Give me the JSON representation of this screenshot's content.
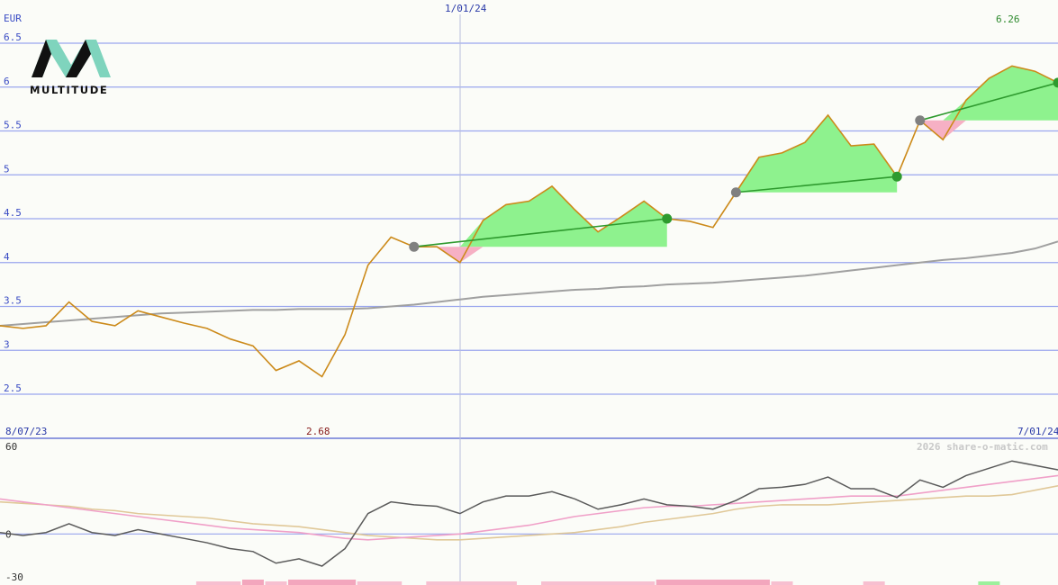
{
  "chart_data": {
    "type": "line",
    "currency": "EUR",
    "last_value": "6.26",
    "min_label": "2.68",
    "date_start": "8/07/23",
    "date_mid": "1/01/24",
    "date_end": "7/01/24",
    "watermark": "2026 share-o-matic.com",
    "logo_text": "MULTITUDE",
    "price": {
      "ylim": [
        2.5,
        6.5
      ],
      "yticks": [
        "2.5",
        "3",
        "3.5",
        "4",
        "4.5",
        "5",
        "5.5",
        "6",
        "6.5"
      ],
      "values": [
        3.28,
        3.25,
        3.28,
        3.55,
        3.33,
        3.28,
        3.45,
        3.38,
        3.31,
        3.25,
        3.13,
        3.05,
        2.77,
        2.88,
        2.7,
        3.18,
        3.97,
        4.29,
        4.18,
        4.18,
        4.0,
        4.48,
        4.66,
        4.7,
        4.87,
        4.6,
        4.35,
        4.52,
        4.7,
        4.5,
        4.47,
        4.4,
        4.8,
        5.2,
        5.25,
        5.37,
        5.68,
        5.33,
        5.35,
        4.98,
        5.62,
        5.4,
        5.85,
        6.1,
        6.24,
        6.18,
        6.05
      ],
      "ma_long": [
        3.28,
        3.3,
        3.32,
        3.34,
        3.36,
        3.38,
        3.4,
        3.42,
        3.43,
        3.44,
        3.45,
        3.46,
        3.46,
        3.47,
        3.47,
        3.47,
        3.48,
        3.5,
        3.52,
        3.55,
        3.58,
        3.61,
        3.63,
        3.65,
        3.67,
        3.69,
        3.7,
        3.72,
        3.73,
        3.75,
        3.76,
        3.77,
        3.79,
        3.81,
        3.83,
        3.85,
        3.88,
        3.91,
        3.94,
        3.97,
        4.0,
        4.03,
        4.05,
        4.08,
        4.11,
        4.16,
        4.24
      ]
    },
    "trades": [
      {
        "from_index": 18,
        "from_value": 4.18,
        "to_index": 29,
        "to_value": 4.5
      },
      {
        "from_index": 32,
        "from_value": 4.8,
        "to_index": 39,
        "to_value": 4.98
      },
      {
        "from_index": 40,
        "from_value": 5.62,
        "to_index": 46,
        "to_value": 6.05
      }
    ],
    "oscillator": {
      "yticks": [
        "60",
        "0",
        "-30"
      ],
      "ylim": [
        -30,
        60
      ],
      "main": [
        1,
        -1,
        1,
        7,
        1,
        -1,
        3,
        0,
        -3,
        -6,
        -10,
        -12,
        -20,
        -17,
        -22,
        -10,
        14,
        22,
        20,
        19,
        14,
        22,
        26,
        26,
        29,
        24,
        17,
        20,
        24,
        20,
        19,
        17,
        23,
        31,
        32,
        34,
        39,
        31,
        31,
        25,
        37,
        32,
        40,
        45,
        50,
        47,
        44
      ],
      "signal": [
        24,
        22,
        20,
        18,
        16,
        14,
        12,
        10,
        8,
        6,
        4,
        3,
        2,
        1,
        -1,
        -3,
        -4,
        -3,
        -2,
        -1,
        0,
        2,
        4,
        6,
        9,
        12,
        14,
        16,
        18,
        19,
        19,
        20,
        21,
        22,
        23,
        24,
        25,
        26,
        26,
        26,
        28,
        30,
        32,
        34,
        36,
        38,
        40
      ],
      "signal2": [
        22,
        21,
        20,
        19,
        17,
        16,
        14,
        13,
        12,
        11,
        9,
        7,
        6,
        5,
        3,
        1,
        -1,
        -2,
        -3,
        -4,
        -4,
        -3,
        -2,
        -1,
        0,
        1,
        3,
        5,
        8,
        10,
        12,
        14,
        17,
        19,
        20,
        20,
        20,
        21,
        22,
        23,
        24,
        25,
        26,
        26,
        27,
        30,
        33
      ],
      "histogram_marks": [
        {
          "from_index": 9,
          "to_index": 10,
          "kind": "neg"
        },
        {
          "from_index": 11,
          "to_index": 11,
          "kind": "neg_strong"
        },
        {
          "from_index": 12,
          "to_index": 12,
          "kind": "neg"
        },
        {
          "from_index": 13,
          "to_index": 15,
          "kind": "neg_strong"
        },
        {
          "from_index": 16,
          "to_index": 17,
          "kind": "neg"
        },
        {
          "from_index": 19,
          "to_index": 22,
          "kind": "neg"
        },
        {
          "from_index": 24,
          "to_index": 28,
          "kind": "neg"
        },
        {
          "from_index": 29,
          "to_index": 33,
          "kind": "neg_strong"
        },
        {
          "from_index": 34,
          "to_index": 34,
          "kind": "neg"
        },
        {
          "from_index": 38,
          "to_index": 38,
          "kind": "neg"
        },
        {
          "from_index": 43,
          "to_index": 43,
          "kind": "pos"
        }
      ]
    },
    "colors": {
      "price": "#cc8a1a",
      "ma_long": "#a0a0a0",
      "grid": "#9aa6ee",
      "gain_fill": "#8ef28e",
      "loss_fill": "#f6b0c4",
      "trade_line": "#2e9a2e",
      "entry_marker": "#808080",
      "exit_marker": "#2e9a2e",
      "osc_main": "#5a5a5a",
      "osc_signal": "#f0a0c8",
      "osc_signal2": "#e0c898",
      "last_value": "#2e8a2e",
      "min_label": "#8a2020",
      "logo_teal": "#7fd4bd"
    }
  }
}
